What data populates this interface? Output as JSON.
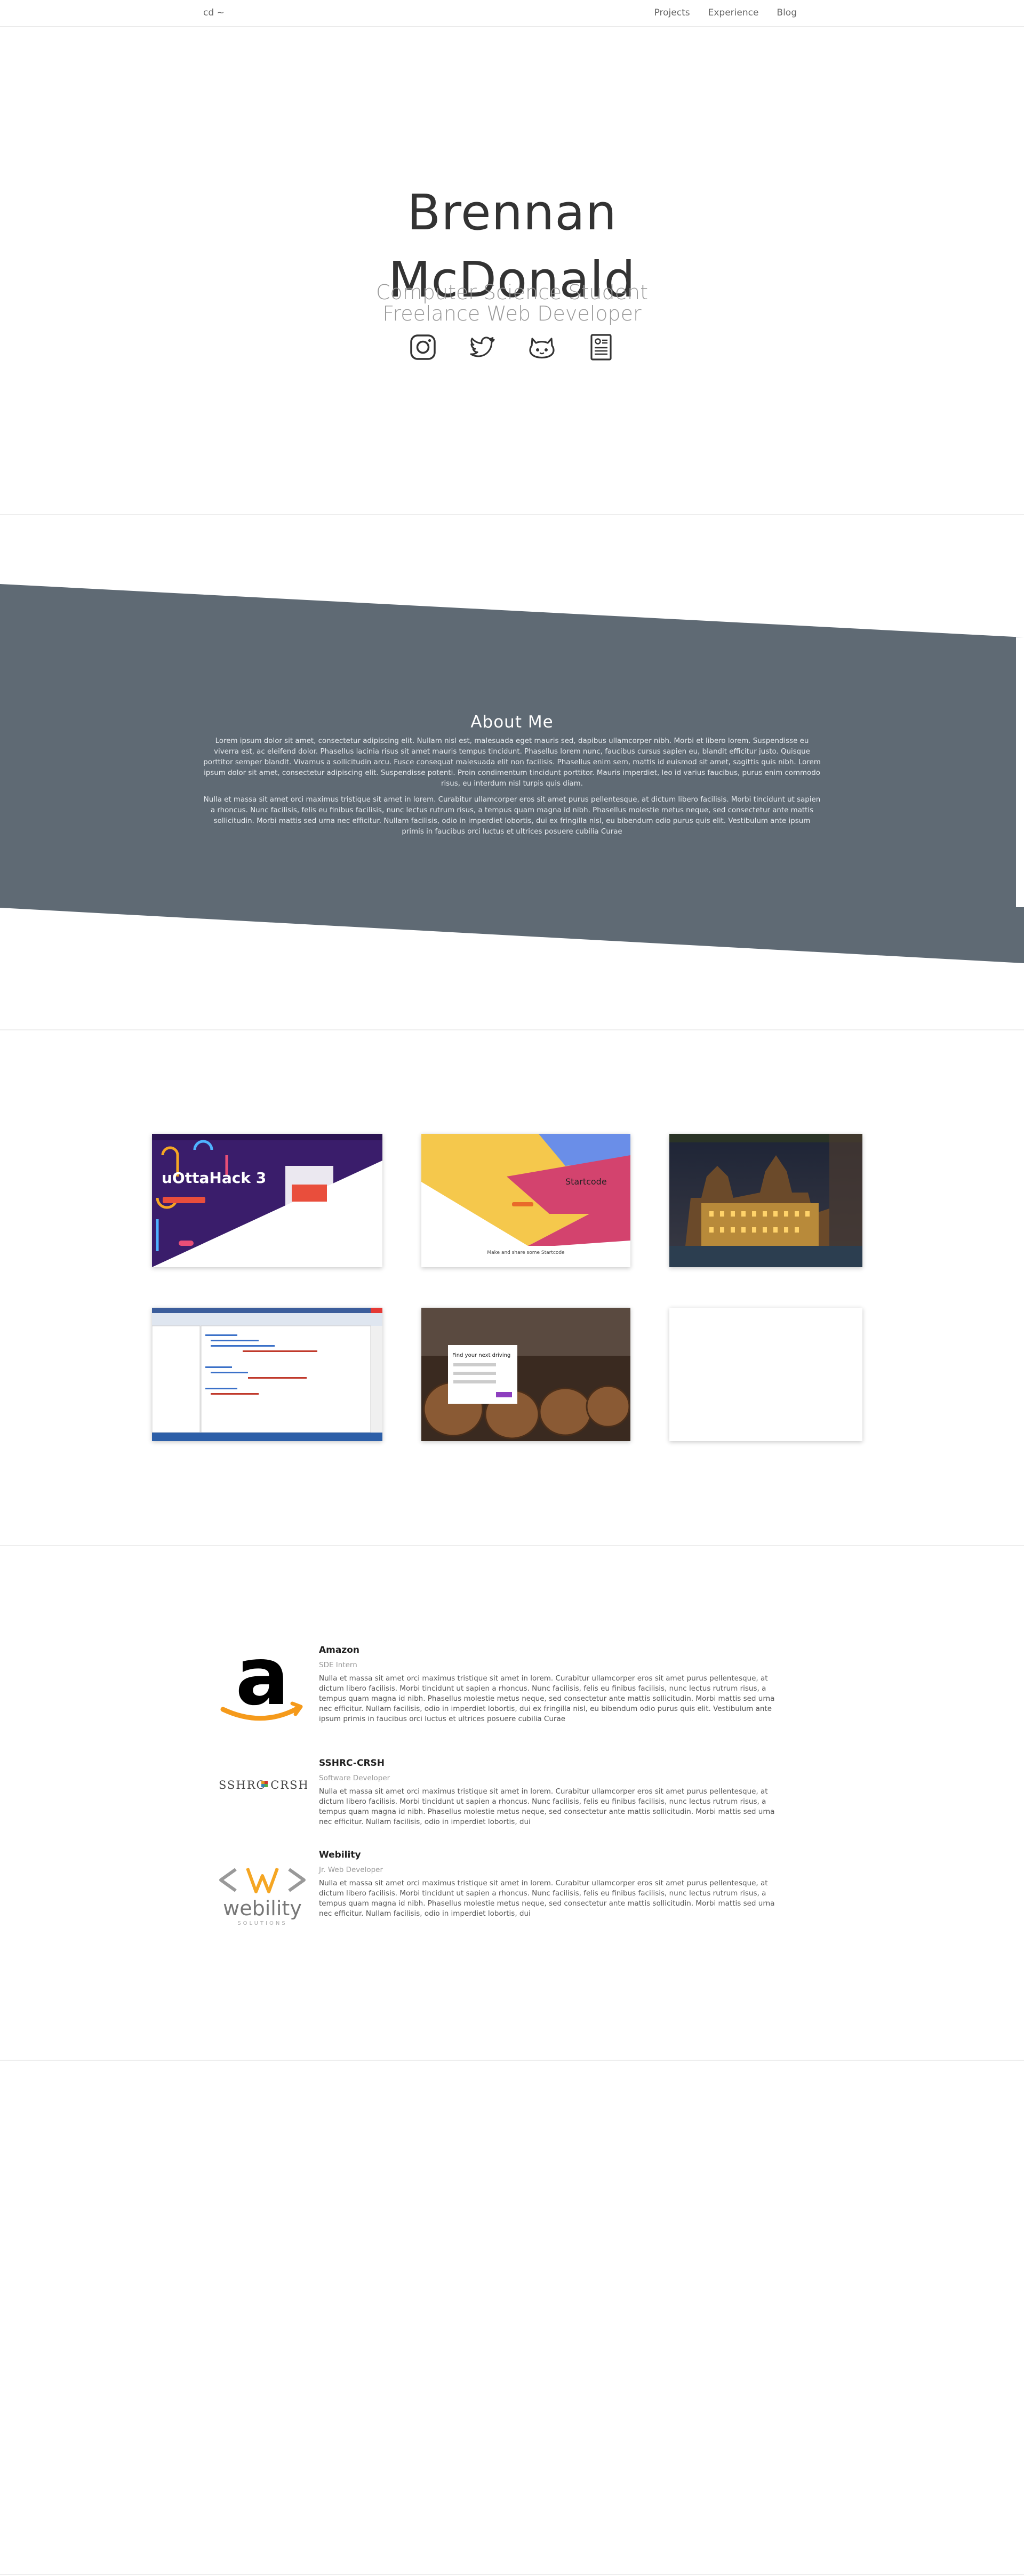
{
  "nav": {
    "brand": "cd ~",
    "links": [
      "Projects",
      "Experience",
      "Blog"
    ]
  },
  "hero": {
    "name_line1": "Brennan",
    "name_line2": "McDonald",
    "subtitle_line1": "Computer Science Student",
    "subtitle_line2": "Freelance Web Developer",
    "social_icons": [
      "instagram-icon",
      "twitter-icon",
      "github-icon",
      "resume-icon"
    ]
  },
  "about": {
    "title": "About Me",
    "paragraph1": "Lorem ipsum dolor sit amet, consectetur adipiscing elit. Nullam nisl est, malesuada eget mauris sed, dapibus ullamcorper nibh. Morbi et libero lorem. Suspendisse eu viverra est, ac eleifend dolor. Phasellus lacinia risus sit amet mauris tempus tincidunt. Phasellus lorem nunc, faucibus cursus sapien eu, blandit efficitur justo. Quisque porttitor semper blandit. Vivamus a sollicitudin arcu. Fusce consequat malesuada elit non facilisis. Phasellus enim sem, mattis id euismod sit amet, sagittis quis nibh. Lorem ipsum dolor sit amet, consectetur adipiscing elit. Suspendisse potenti. Proin condimentum tincidunt porttitor. Mauris imperdiet, leo id varius faucibus, purus enim commodo risus, eu interdum nisl turpis quis diam.",
    "paragraph2": "Nulla et massa sit amet orci maximus tristique sit amet in lorem. Curabitur ullamcorper eros sit amet purus pellentesque, at dictum libero facilisis. Morbi tincidunt ut sapien a rhoncus. Nunc facilisis, felis eu finibus facilisis, nunc lectus rutrum risus, a tempus quam magna id nibh. Phasellus molestie metus neque, sed consectetur ante mattis sollicitudin. Morbi mattis sed urna nec efficitur. Nullam facilisis, odio in imperdiet lobortis, dui ex fringilla nisl, eu bibendum odio purus quis elit. Vestibulum ante ipsum primis in faucibus orci luctus et ultrices posuere cubilia Curae"
  },
  "projects": {
    "card1": {
      "title": "uOttaHack 3"
    },
    "card2": {
      "title": "Startcode",
      "caption": "Make and share some Startcode"
    },
    "card3": {},
    "card4": {},
    "card5": {
      "title": "Find your next driving"
    },
    "card6": {}
  },
  "experience": [
    {
      "company": "Amazon",
      "role": "SDE Intern",
      "logo_letter": "a",
      "description": "Nulla et massa sit amet orci maximus tristique sit amet in lorem. Curabitur ullamcorper eros sit amet purus pellentesque, at dictum libero facilisis. Morbi tincidunt ut sapien a rhoncus. Nunc facilisis, felis eu finibus facilisis, nunc lectus rutrum risus, a tempus quam magna id nibh. Phasellus molestie metus neque, sed consectetur ante mattis sollicitudin. Morbi mattis sed urna nec efficitur. Nullam facilisis, odio in imperdiet lobortis, dui ex fringilla nisl, eu bibendum odio purus quis elit. Vestibulum ante ipsum primis in faucibus orci luctus et ultrices posuere cubilia Curae"
    },
    {
      "company": "SSHRC-CRSH",
      "role": "Software Developer",
      "logo_text": "SSHRC CRSH",
      "description": "Nulla et massa sit amet orci maximus tristique sit amet in lorem. Curabitur ullamcorper eros sit amet purus pellentesque, at dictum libero facilisis. Morbi tincidunt ut sapien a rhoncus. Nunc facilisis, felis eu finibus facilisis, nunc lectus rutrum risus, a tempus quam magna id nibh. Phasellus molestie metus neque, sed consectetur ante mattis sollicitudin. Morbi mattis sed urna nec efficitur. Nullam facilisis, odio in imperdiet lobortis, dui"
    },
    {
      "company": "Webility",
      "role": "Jr. Web Developer",
      "logo_text": "webility",
      "logo_tagline": "SOLUTIONS",
      "description": "Nulla et massa sit amet orci maximus tristique sit amet in lorem. Curabitur ullamcorper eros sit amet purus pellentesque, at dictum libero facilisis. Morbi tincidunt ut sapien a rhoncus. Nunc facilisis, felis eu finibus facilisis, nunc lectus rutrum risus, a tempus quam magna id nibh. Phasellus molestie metus neque, sed consectetur ante mattis sollicitudin. Morbi mattis sed urna nec efficitur. Nullam facilisis, odio in imperdiet lobortis, dui"
    }
  ],
  "colors": {
    "about_bg": "#5f6a74",
    "text_dark": "#333333",
    "text_muted": "#999999",
    "amazon_orange": "#f59a1b",
    "purple": "#3a1d6b",
    "startcode_yellow": "#f5c84c",
    "startcode_pink": "#d3436e"
  }
}
